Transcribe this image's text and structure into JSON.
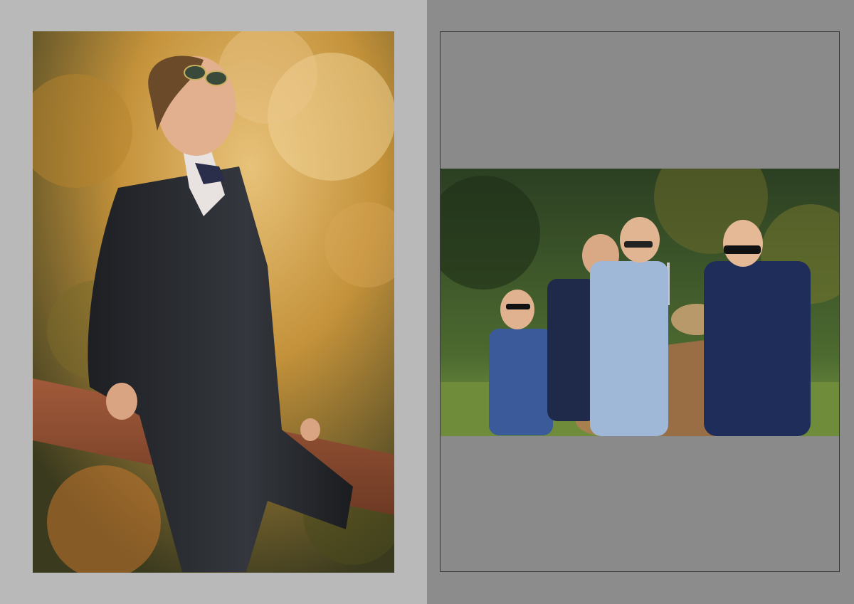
{
  "page": {
    "left_background": "#b9b9b9",
    "right_background": "#8c8c8c",
    "frame_border": "#3a3a3a"
  },
  "left_photo": {
    "subject": "boy-in-tuxedo-on-fence",
    "colors": {
      "foliage": "#c9962e",
      "suit": "#2a2c30",
      "fence": "#8a4a30"
    }
  },
  "right_photo": {
    "subject": "four-boys-with-scooter",
    "colors": {
      "park": "#3d5a2a",
      "grass": "#6d8a3a",
      "light-suit": "#9fb8d8",
      "navy-suit": "#1f2a4a",
      "scooter": "#a88050"
    }
  }
}
